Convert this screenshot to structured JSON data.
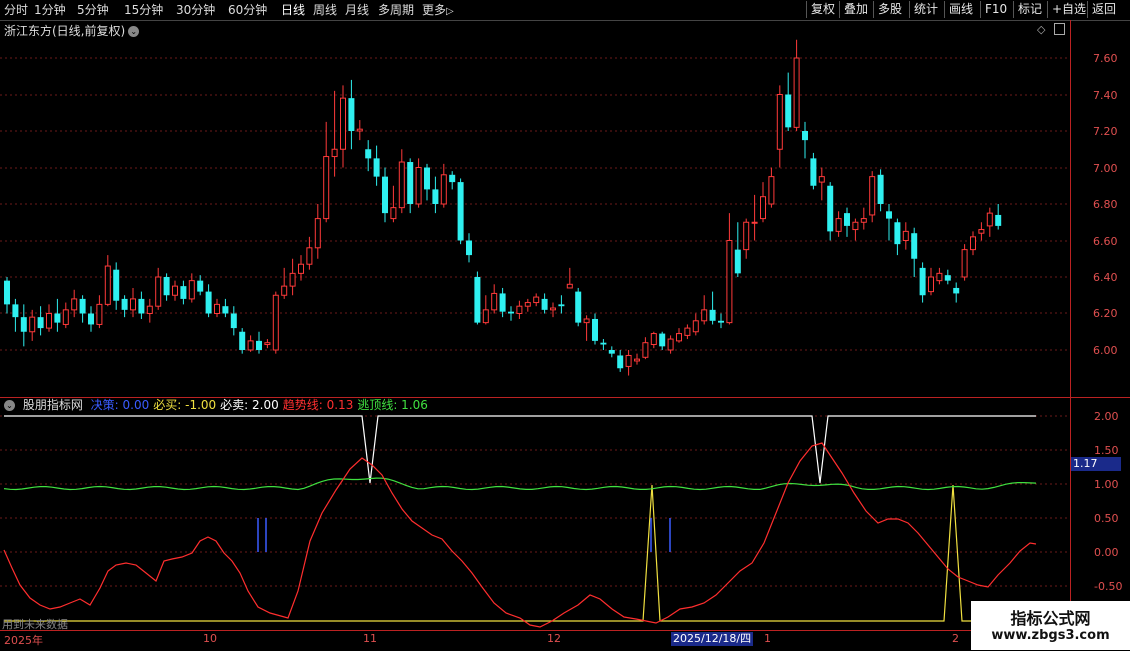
{
  "toolbar": {
    "timeframes": [
      "分时",
      "1分钟",
      "5分钟",
      "15分钟",
      "30分钟",
      "60分钟",
      "日线",
      "周线",
      "月线",
      "多周期",
      "更多"
    ],
    "more_arrow": "▷",
    "active_index": 6,
    "right_buttons": [
      "复权",
      "叠加",
      "多股",
      "统计",
      "画线",
      "F10",
      "标记",
      "+自选",
      "返回"
    ]
  },
  "stock": {
    "title": "浙江东方(日线,前复权)",
    "title_icon": "chevron-down-icon"
  },
  "price_axis": [
    "7.60",
    "7.40",
    "7.20",
    "7.00",
    "6.80",
    "6.60",
    "6.40",
    "6.20",
    "6.00"
  ],
  "indicator": {
    "name": "股朋指标网",
    "items": [
      {
        "label": "决策:",
        "value": "0.00",
        "color": "#3a5cff"
      },
      {
        "label": "必买:",
        "value": "-1.00",
        "color": "#f0e040"
      },
      {
        "label": "必卖:",
        "value": "2.00",
        "color": "#ffffff"
      },
      {
        "label": "趋势线:",
        "value": "0.13",
        "color": "#ff3030"
      },
      {
        "label": "逃顶线:",
        "value": "1.06",
        "color": "#40e040"
      }
    ],
    "axis": [
      "2.00",
      "1.50",
      "1.17",
      "1.00",
      "0.50",
      "0.00",
      "-0.50"
    ],
    "current_value": "1.17"
  },
  "future_note": "用到未来数据",
  "date_axis": {
    "labels": [
      "2025年",
      "10",
      "11",
      "12",
      "1",
      "2"
    ],
    "cursor_date": "2025/12/18/四"
  },
  "watermark": {
    "line1": "指标公式网",
    "line2": "www.zbgs3.com"
  },
  "colors": {
    "up": "#ff3a3a",
    "down": "#2ff0f0",
    "grid": "#6b1a1a",
    "border": "#bb2222"
  }
}
